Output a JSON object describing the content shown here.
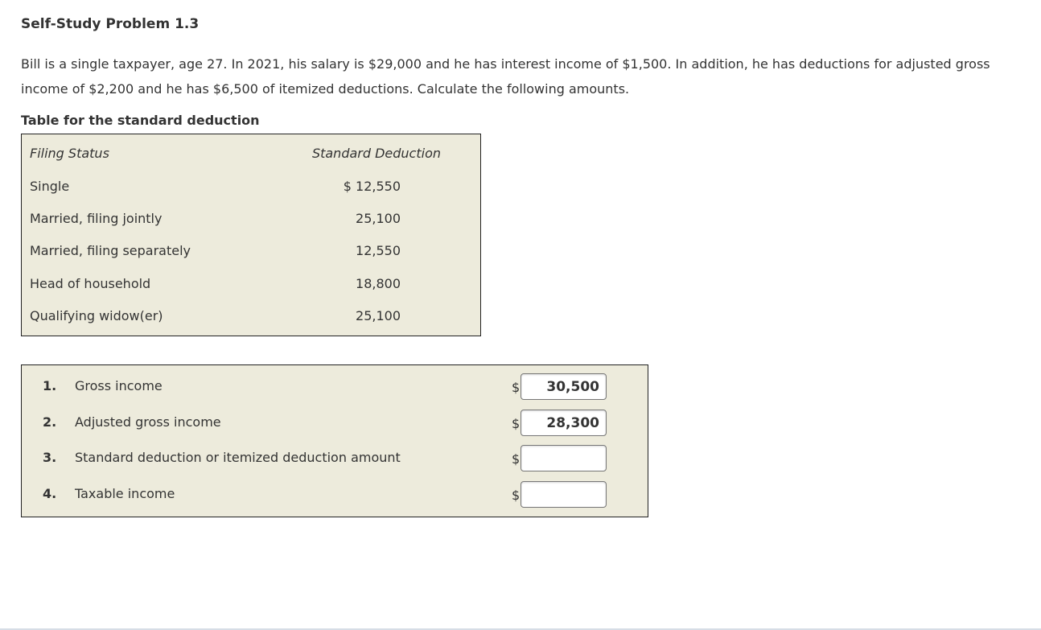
{
  "page": {
    "title": "Self-Study Problem 1.3",
    "problem_text": "Bill is a single taxpayer, age 27. In 2021, his salary is $29,000 and he has interest income of $1,500. In addition, he has deductions for adjusted gross income of $2,200 and he has $6,500 of itemized deductions. Calculate the following amounts."
  },
  "standard_table": {
    "caption": "Table for the standard deduction",
    "headers": {
      "status": "Filing Status",
      "amount": "Standard Deduction"
    },
    "rows": [
      {
        "status": "Single",
        "amount": "$ 12,550"
      },
      {
        "status": "Married, filing jointly",
        "amount": "25,100"
      },
      {
        "status": "Married, filing separately",
        "amount": "12,550"
      },
      {
        "status": "Head of household",
        "amount": "18,800"
      },
      {
        "status": "Qualifying widow(er)",
        "amount": "25,100"
      }
    ]
  },
  "questions": [
    {
      "number": "1.",
      "label": "Gross income",
      "currency": "$",
      "value": "30,500"
    },
    {
      "number": "2.",
      "label": "Adjusted gross income",
      "currency": "$",
      "value": "28,300"
    },
    {
      "number": "3.",
      "label": "Standard deduction or itemized deduction amount",
      "currency": "$",
      "value": ""
    },
    {
      "number": "4.",
      "label": "Taxable income",
      "currency": "$",
      "value": ""
    }
  ]
}
